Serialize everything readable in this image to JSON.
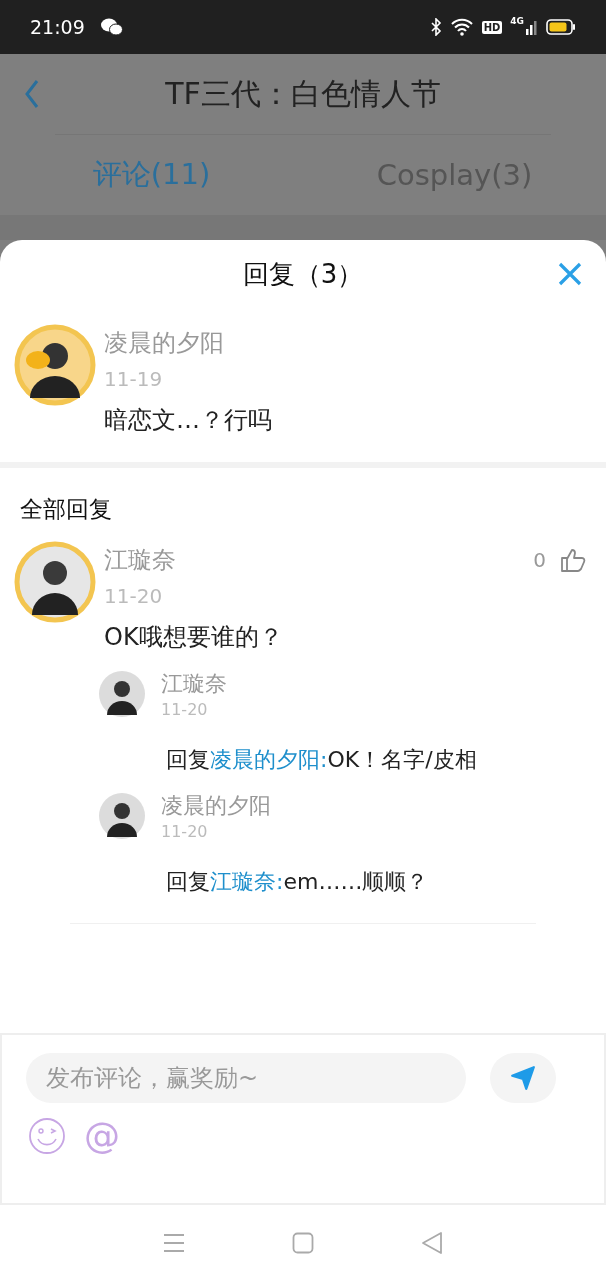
{
  "status_bar": {
    "time": "21:09",
    "badges": [
      "HD",
      "4G"
    ]
  },
  "header": {
    "title": "TF三代：白色情人节"
  },
  "tabs": [
    {
      "label": "评论(11)",
      "selected": true
    },
    {
      "label": "Cosplay(3)",
      "selected": false
    }
  ],
  "sheet": {
    "title": "回复（3）",
    "root": {
      "name": "凌晨的夕阳",
      "date": "11-19",
      "text": "暗恋文…？行吗"
    },
    "section_title": "全部回复",
    "comment": {
      "name": "江璇奈",
      "date": "11-20",
      "text": "OK哦想要谁的？",
      "likes": "0",
      "replies": [
        {
          "name": "江璇奈",
          "date": "11-20",
          "prefix": "回复",
          "target": "凌晨的夕阳:",
          "body": "OK！名字/皮相"
        },
        {
          "name": "凌晨的夕阳",
          "date": "11-20",
          "prefix": "回复",
          "target": "江璇奈:",
          "body": "em……顺顺？"
        }
      ]
    }
  },
  "composer": {
    "placeholder": "发布评论，赢奖励~",
    "mention": "@"
  }
}
